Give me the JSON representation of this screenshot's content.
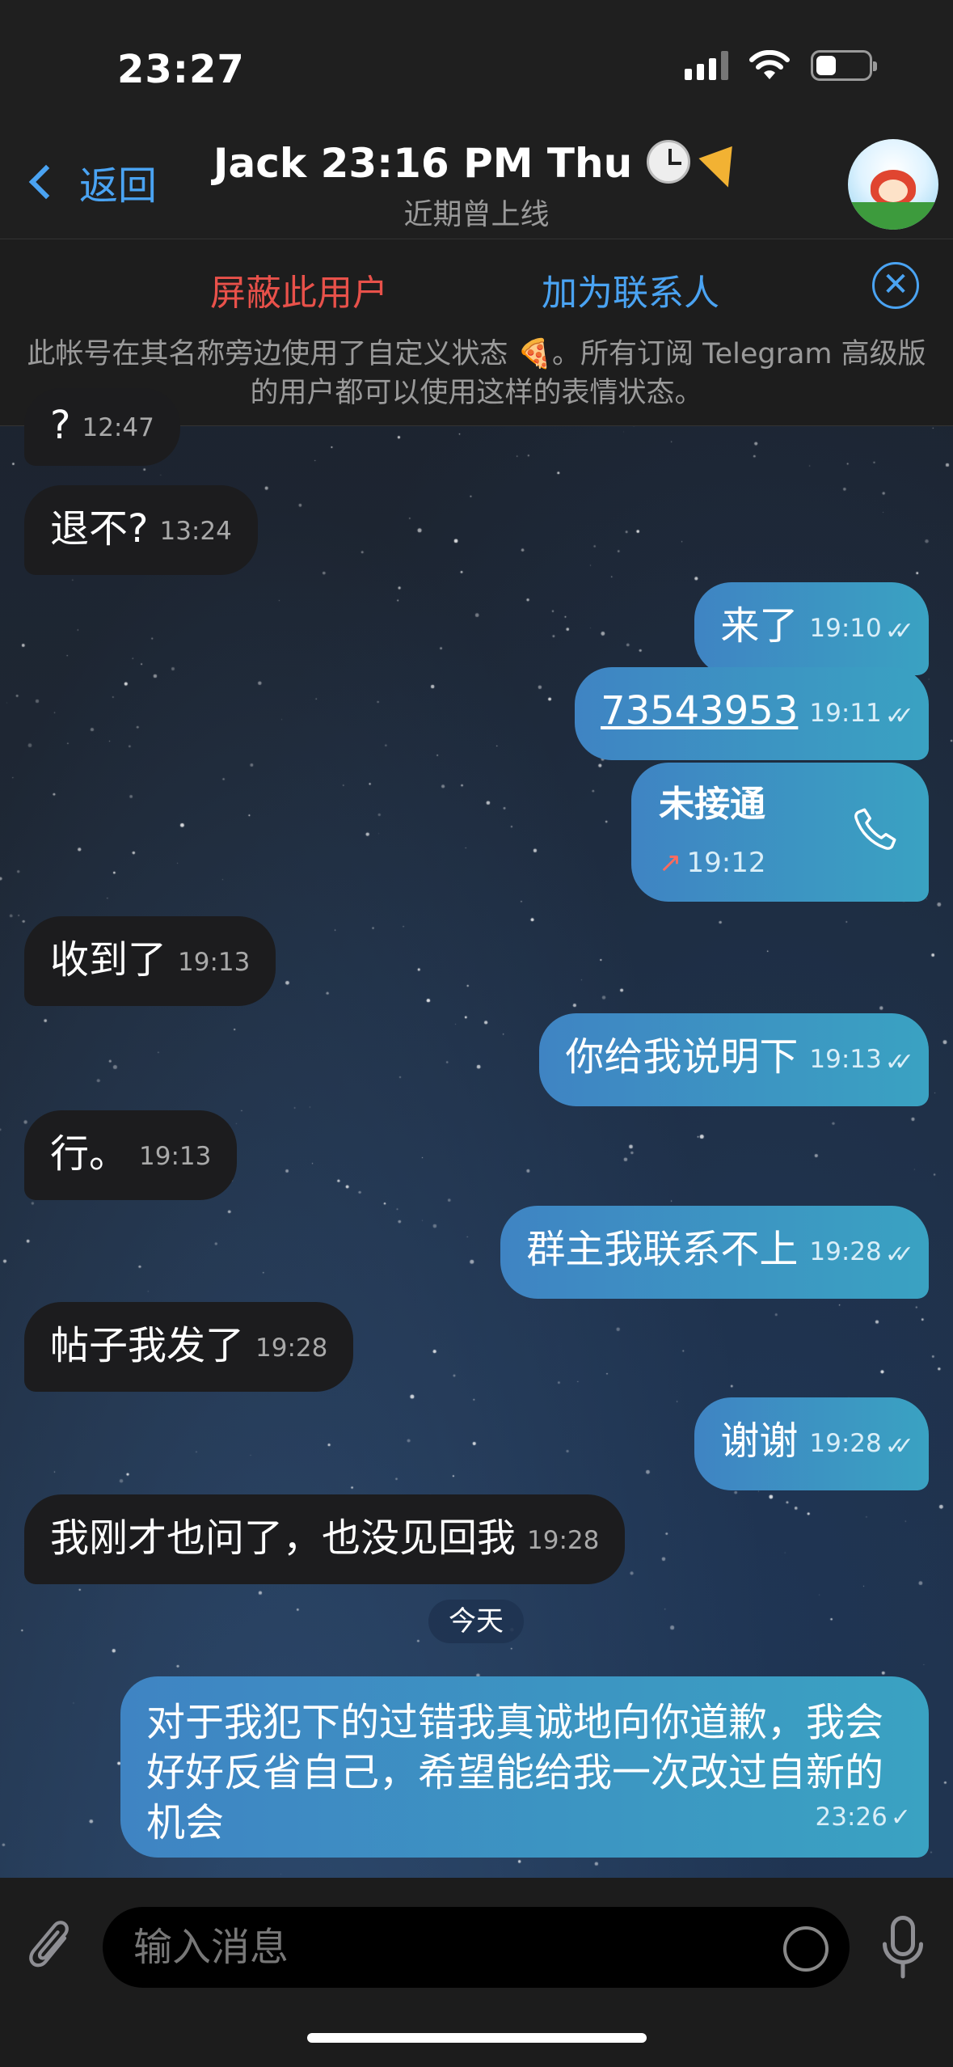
{
  "status_bar": {
    "time": "23:27"
  },
  "header": {
    "back_label": "返回",
    "title": "Jack 23:16 PM Thu",
    "subtitle": "近期曾上线"
  },
  "banner": {
    "block_label": "屏蔽此用户",
    "add_contact_label": "加为联系人",
    "close_glyph": "✕",
    "notice": "此帐号在其名称旁边使用了自定义状态 🍕。所有订阅 Telegram 高级版的用户都可以使用这样的表情状态。"
  },
  "messages": [
    {
      "dir": "in",
      "text": "?",
      "time": "12:47"
    },
    {
      "dir": "in",
      "text": "退不?",
      "time": "13:24"
    },
    {
      "dir": "out",
      "text": "来了",
      "time": "19:10",
      "ticks": "✓✓"
    },
    {
      "dir": "out",
      "text": "73543953",
      "time": "19:11",
      "ticks": "✓✓"
    },
    {
      "dir": "out",
      "type": "call",
      "text": "未接通",
      "time": "19:12",
      "arrow": "↗"
    },
    {
      "dir": "in",
      "text": "收到了",
      "time": "19:13"
    },
    {
      "dir": "out",
      "text": "你给我说明下",
      "time": "19:13",
      "ticks": "✓✓"
    },
    {
      "dir": "in",
      "text": "行。",
      "time": "19:13"
    },
    {
      "dir": "out",
      "text": "群主我联系不上",
      "time": "19:28",
      "ticks": "✓✓"
    },
    {
      "dir": "in",
      "text": "帖子我发了",
      "time": "19:28"
    },
    {
      "dir": "out",
      "text": "谢谢",
      "time": "19:28",
      "ticks": "✓✓"
    },
    {
      "dir": "in",
      "text": "我刚才也问了，也没见回我",
      "time": "19:28"
    },
    {
      "dir": "out",
      "text": "对于我犯下的过错我真诚地向你道歉，我会好好反省自己，希望能给我一次改过自新的机会",
      "time": "23:26",
      "ticks": "✓"
    }
  ],
  "date_separator": "今天",
  "composer": {
    "placeholder": "输入消息"
  },
  "icons": {
    "back": "chevron-left-icon",
    "close": "close-circle-icon",
    "call": "phone-icon",
    "attach": "paperclip-icon",
    "sticker": "sticker-icon",
    "mic": "microphone-icon"
  },
  "colors": {
    "accent_blue": "#4aa3f2",
    "danger_red": "#e8514a",
    "incoming_bubble": "#1c1c1e",
    "outgoing_bubble_start": "#3f84c3",
    "outgoing_bubble_end": "#3aa2c2"
  }
}
